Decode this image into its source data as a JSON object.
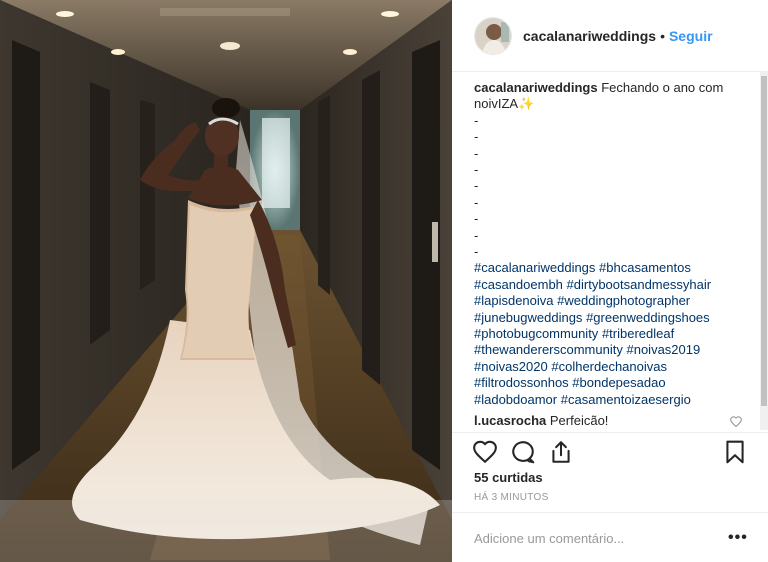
{
  "post": {
    "username": "cacalanariweddings",
    "follow_label": "Seguir",
    "header_separator": "•"
  },
  "caption": {
    "username": "cacalanariweddings",
    "text": "Fechando o ano com noivIZA",
    "emoji": "✨",
    "dashes": [
      "-",
      "-",
      "-",
      "-",
      "-",
      "-",
      "-",
      "-",
      "-"
    ],
    "hashtags": [
      "#cacalanariweddings",
      "#bhcasamentos",
      "#casandoembh",
      "#dirtybootsandmessyhair",
      "#lapisdenoiva",
      "#weddingphotographer",
      "#junebugweddings",
      "#greenweddingshoes",
      "#photobugcommunity",
      "#triberedleaf",
      "#thewandererscommunity",
      "#noivas2019",
      "#noivas2020",
      "#colherdechanoivas",
      "#filtrodossonhos",
      "#bondepesadao",
      "#ladobdoamor",
      "#casamentoizaesergio"
    ]
  },
  "comment": {
    "username": "l.ucasrocha",
    "text": "Perfeicão!"
  },
  "stats": {
    "likes": "55 curtidas",
    "time": "HÁ 3 MINUTOS"
  },
  "add_comment": {
    "placeholder": "Adicione um comentário...",
    "more_label": "•••"
  },
  "icons": {
    "like": "heart-icon",
    "comment": "comment-bubble-icon",
    "share": "share-icon",
    "save": "bookmark-icon"
  },
  "colors": {
    "link": "#3897f0",
    "hashtag": "#003569",
    "muted": "#999999"
  }
}
